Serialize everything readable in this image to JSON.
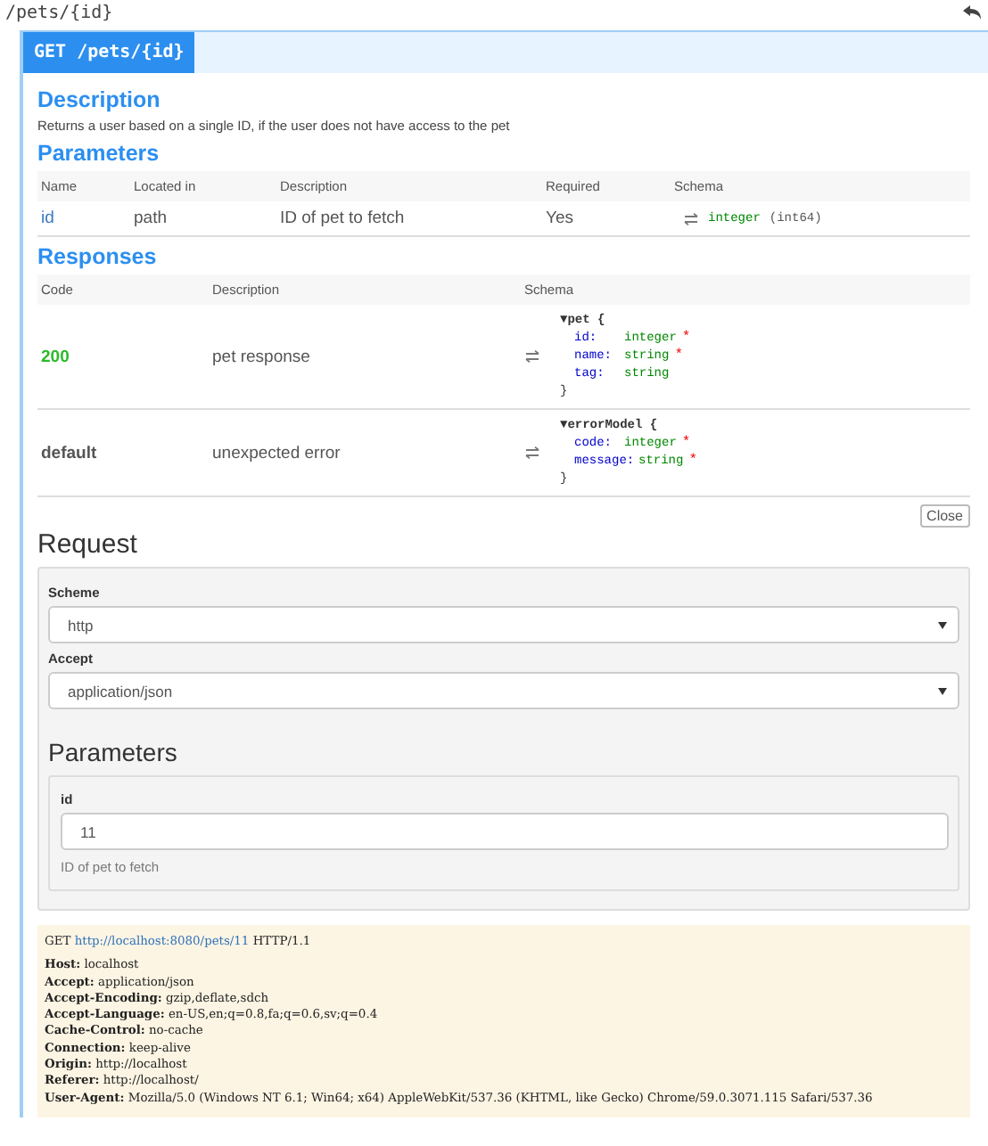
{
  "path_title": "/pets/{id}",
  "operation": {
    "label": "GET /pets/{id}"
  },
  "description": {
    "title": "Description",
    "text": "Returns a user based on a single ID, if the user does not have access to the pet"
  },
  "parameters": {
    "title": "Parameters",
    "columns": [
      "Name",
      "Located in",
      "Description",
      "Required",
      "Schema"
    ],
    "rows": [
      {
        "name": "id",
        "location": "path",
        "description": "ID of pet to fetch",
        "required": "Yes",
        "type": "integer",
        "format": "(int64)"
      }
    ]
  },
  "responses": {
    "title": "Responses",
    "columns": [
      "Code",
      "Description",
      "Schema"
    ],
    "rows": [
      {
        "code": "200",
        "success": true,
        "description": "pet response",
        "model": {
          "toggle": "▼",
          "name": "pet",
          "open": "{",
          "close": "}",
          "fields": [
            {
              "name": "id:",
              "type": "integer",
              "required_mark": "*"
            },
            {
              "name": "name:",
              "type": "string",
              "required_mark": "*"
            },
            {
              "name": "tag:",
              "type": "string"
            }
          ]
        }
      },
      {
        "code": "default",
        "success": false,
        "description": "unexpected error",
        "model": {
          "toggle": "▼",
          "name": "errorModel",
          "open": "{",
          "close": "}",
          "fields": [
            {
              "name": "code:",
              "type": "integer",
              "required_mark": "*"
            },
            {
              "name": "message:",
              "type": "string",
              "required_mark": "*"
            }
          ]
        }
      }
    ]
  },
  "close_button": "Close",
  "request": {
    "title": "Request",
    "selects": [
      {
        "label": "Scheme",
        "value": "http"
      },
      {
        "label": "Accept",
        "value": "application/json"
      }
    ],
    "parameters_title": "Parameters",
    "fields": [
      {
        "label": "id",
        "value": "11",
        "help": "ID of pet to fetch"
      }
    ]
  },
  "raw_request": {
    "method": "GET",
    "url": "http://localhost:8080/pets/11",
    "protocol": "HTTP/1.1",
    "headers": [
      {
        "name": "Host:",
        "value": "localhost"
      },
      {
        "name": "Accept:",
        "value": "application/json"
      },
      {
        "name": "Accept-Encoding:",
        "value": "gzip,deflate,sdch"
      },
      {
        "name": "Accept-Language:",
        "value": "en-US,en;q=0.8,fa;q=0.6,sv;q=0.4"
      },
      {
        "name": "Cache-Control:",
        "value": "no-cache"
      },
      {
        "name": "Connection:",
        "value": "keep-alive"
      },
      {
        "name": "Origin:",
        "value": "http://localhost"
      },
      {
        "name": "Referer:",
        "value": "http://localhost/"
      },
      {
        "name": "User-Agent:",
        "value": "Mozilla/5.0 (Windows NT 6.1; Win64; x64) AppleWebKit/537.36 (KHTML, like Gecko) Chrome/59.0.3071.115 Safari/537.36"
      }
    ]
  }
}
